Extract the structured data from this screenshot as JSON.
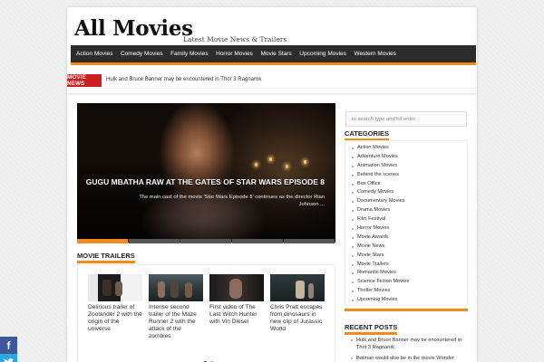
{
  "site": {
    "title": "All Movies",
    "tagline": "Latest Movie News & Trailers"
  },
  "nav": {
    "items": [
      "Action Movies",
      "Comedy Movies",
      "Family Movies",
      "Horror Movies",
      "Movie Stars",
      "Upcoming Movies",
      "Western Movies"
    ]
  },
  "ticker": {
    "label": "MOVIE NEWS",
    "text": "Hulk and Bruce Banner may be encountered in Thor 3 Ragnarok"
  },
  "slider": {
    "title": "GUGU MBATHA RAW AT THE GATES OF STAR WARS EPISODE 8",
    "description": "The main cast of the movie 'Star Wars Episode 8' continues as the director Rian Johnson ...",
    "active_tab": 1,
    "tab_count": 5
  },
  "trailers": {
    "heading": "MOVIE TRAILERS",
    "items": [
      {
        "title": "Delirious trailer of Zoolander 2 with the origin of the universe"
      },
      {
        "title": "Intense second trailer of the Maze Runner 2 with the attack of the zombies"
      },
      {
        "title": "First video of The Last Witch Hunter with Vin Diesel"
      },
      {
        "title": "Chris Pratt escapes from dinosaurs in new clip of Jurassic World"
      }
    ],
    "active_page": 1,
    "page_count": 2
  },
  "search": {
    "placeholder": "to search type and hit enter"
  },
  "categories": {
    "heading": "CATEGORIES",
    "items": [
      "Action Movies",
      "Adventure Movies",
      "Animation Movies",
      "Behind the scenes",
      "Box Office",
      "Comedy Movies",
      "Documentary Movies",
      "Drama Movies",
      "Film Festival",
      "Horror Movies",
      "Movie Awards",
      "Movie News",
      "Movie Stars",
      "Movie Trailers",
      "Romantic Movies",
      "Science Fiction Movies",
      "Thriller Movies",
      "Upcoming Movies"
    ]
  },
  "recent_posts": {
    "heading": "RECENT POSTS",
    "items": [
      "Hulk and Bruce Banner may be encountered in Thor 3 Ragnarok",
      "Batman would also be in the movie Wonder Woman"
    ]
  },
  "social": {
    "facebook_color": "#3b5998",
    "twitter_color": "#2aa9e0"
  },
  "colors": {
    "accent": "#ef8c1d",
    "nav_bg": "#2c2c2c",
    "ticker_label_bg": "#cc1f1f"
  }
}
